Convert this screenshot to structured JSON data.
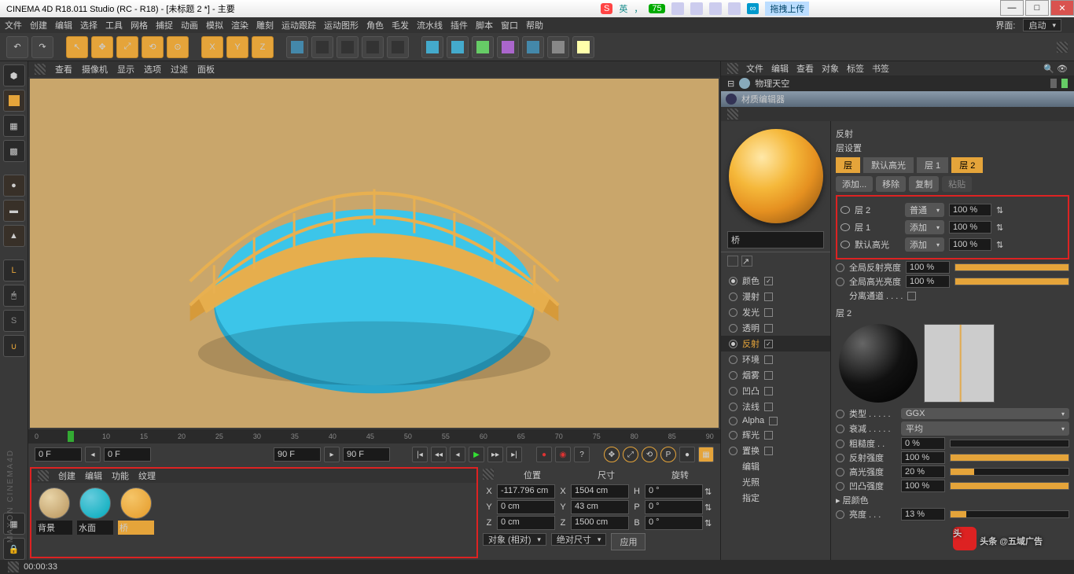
{
  "title": "CINEMA 4D R18.011 Studio (RC - R18) - [未标题 2 *] - 主要",
  "ime": {
    "input": "英",
    "count": "75",
    "cloud_btn": "拖拽上传"
  },
  "menu": {
    "file": "文件",
    "edit": "创建",
    "create": "编辑",
    "sel": "选择",
    "tool": "工具",
    "mesh": "网格",
    "capture": "捕捉",
    "anim": "动画",
    "sim": "模拟",
    "render": "渲染",
    "sculpt": "雕刻",
    "motion": "运动跟踪",
    "mograph": "运动图形",
    "char": "角色",
    "hair": "毛发",
    "pipe": "流水线",
    "plugin": "插件",
    "script": "脚本",
    "window": "窗口",
    "help": "帮助",
    "iface": "界面:",
    "layout": "启动"
  },
  "viewmenu": {
    "view": "查看",
    "cam": "摄像机",
    "disp": "显示",
    "opt": "选项",
    "filter": "过滤",
    "panel": "面板"
  },
  "objmenu": {
    "file": "文件",
    "edit": "编辑",
    "view": "查看",
    "obj": "对象",
    "tag": "标签",
    "bookmark": "书签"
  },
  "skyobj": "物理天空",
  "matedit": {
    "title": "材质编辑器",
    "name": "桥",
    "reflect": "反射",
    "layerset": "层设置",
    "tabs": {
      "layer": "层",
      "def": "默认高光",
      "l1": "层 1",
      "l2": "层 2"
    },
    "btns": {
      "add": "添加...",
      "rem": "移除",
      "copy": "复制",
      "paste": "粘贴"
    },
    "rows": [
      {
        "name": "层 2",
        "mode": "普通",
        "pct": "100 %"
      },
      {
        "name": "层 1",
        "mode": "添加",
        "pct": "100 %"
      },
      {
        "name": "默认高光",
        "mode": "添加",
        "pct": "100 %"
      }
    ],
    "global_refl": "全局反射亮度",
    "global_spec": "全局高光亮度",
    "g_pct": "100 %",
    "sep": "分离通道 . . . .",
    "l2hdr": "层 2",
    "props": {
      "type": {
        "lbl": "类型 . . . . .",
        "val": "GGX"
      },
      "atten": {
        "lbl": "衰减 . . . . .",
        "val": "平均"
      },
      "rough": {
        "lbl": "粗糙度 . .",
        "val": "0 %",
        "pct": 0
      },
      "refl": {
        "lbl": "反射强度",
        "val": "100 %",
        "pct": 100
      },
      "spec": {
        "lbl": "高光强度",
        "val": "20 %",
        "pct": 20
      },
      "bump": {
        "lbl": "凹凸强度",
        "val": "100 %",
        "pct": 100
      },
      "layercolor": "层颜色",
      "bright": {
        "lbl": "亮度 . . .",
        "val": "13 %",
        "pct": 13
      }
    }
  },
  "channels": {
    "color": "颜色",
    "diffuse": "漫射",
    "lumin": "发光",
    "trans": "透明",
    "reflect": "反射",
    "env": "环境",
    "fog": "烟雾",
    "bump": "凹凸",
    "normal": "法线",
    "alpha": "Alpha",
    "glow": "辉光",
    "displace": "置换",
    "editor": "编辑",
    "illum": "光照",
    "assign": "指定"
  },
  "matmenu": {
    "create": "创建",
    "edit": "编辑",
    "func": "功能",
    "tex": "纹理"
  },
  "materials": [
    {
      "name": "背景"
    },
    {
      "name": "水面"
    },
    {
      "name": "桥"
    }
  ],
  "coord": {
    "pos": "位置",
    "size": "尺寸",
    "rot": "旋转",
    "x": {
      "p": "-117.796 cm",
      "s": "1504 cm",
      "r": "0 °"
    },
    "y": {
      "p": "0 cm",
      "s": "43 cm",
      "r": "0 °"
    },
    "z": {
      "p": "0 cm",
      "s": "1500 cm",
      "r": "0 °"
    },
    "obj": "对象 (相对)",
    "abs": "绝对尺寸",
    "apply": "应用"
  },
  "timeline": {
    "start": "0 F",
    "cur": "0 F",
    "end1": "90 F",
    "end2": "90 F",
    "ticks": [
      "0",
      "5",
      "10",
      "15",
      "20",
      "25",
      "30",
      "35",
      "40",
      "45",
      "50",
      "55",
      "60",
      "65",
      "70",
      "75",
      "80",
      "85",
      "90"
    ]
  },
  "status": "00:00:33",
  "watermark": "头条 @五域广告",
  "vertlogo": "MAXON CINEMA4D"
}
